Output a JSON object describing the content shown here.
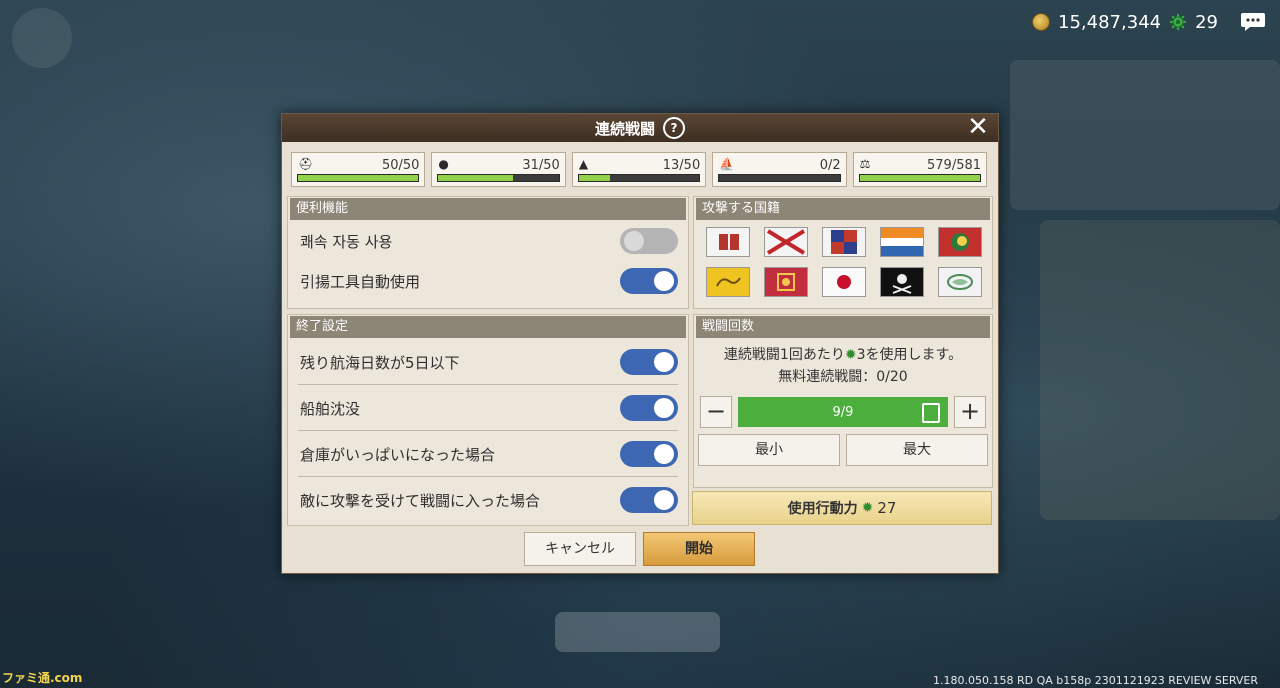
{
  "topbar": {
    "coins": "15,487,344",
    "action_points": "29"
  },
  "watermark": "ファミ通.com",
  "version": "1.180.050.158 RD QA b158p 2301121923 REVIEW SERVER",
  "dialog": {
    "title": "連続戦闘",
    "help": "?",
    "close": "✕",
    "stats": [
      {
        "icon": "crew-icon",
        "value": "50/50",
        "fill": 1.0
      },
      {
        "icon": "food-bag-icon",
        "value": "31/50",
        "fill": 0.62
      },
      {
        "icon": "sailors-icon",
        "value": "13/50",
        "fill": 0.26
      },
      {
        "icon": "ship-icon",
        "value": "0/2",
        "fill": 0.0
      },
      {
        "icon": "scale-icon",
        "value": "579/581",
        "fill": 0.997
      }
    ],
    "convenience": {
      "title": "便利機能",
      "items": [
        {
          "label": "쾌속 자동 사용",
          "on": false
        },
        {
          "label": "引揚工具自動使用",
          "on": true
        }
      ]
    },
    "end_settings": {
      "title": "終了設定",
      "items": [
        {
          "label": "残り航海日数が5日以下",
          "on": true
        },
        {
          "label": "船舶沈没",
          "on": true
        },
        {
          "label": "倉庫がいっぱいになった場合",
          "on": true
        },
        {
          "label": "敵に攻撃を受けて戦闘に入った場合",
          "on": true
        }
      ]
    },
    "nationality": {
      "title": "攻撃する国籍",
      "flags": [
        "portugal-flag",
        "burgundy-cross-flag",
        "england-royal-flag",
        "netherlands-flag",
        "ottoman-flag",
        "china-flag",
        "venice-flag",
        "japan-flag",
        "pirate-flag",
        "hanseatic-flag"
      ]
    },
    "battle_count": {
      "title": "戦闘回数",
      "note_line1_pre": "連続戦闘1回あたり",
      "note_line1_post": "3を使用します。",
      "note_line2": "無料連続戦闘：0/20",
      "minus": "−",
      "plus": "+",
      "value": "9/9",
      "min_label": "最小",
      "max_label": "最大"
    },
    "cost_label": "使用行動力",
    "cost_value": "27",
    "cancel_label": "キャンセル",
    "start_label": "開始"
  }
}
